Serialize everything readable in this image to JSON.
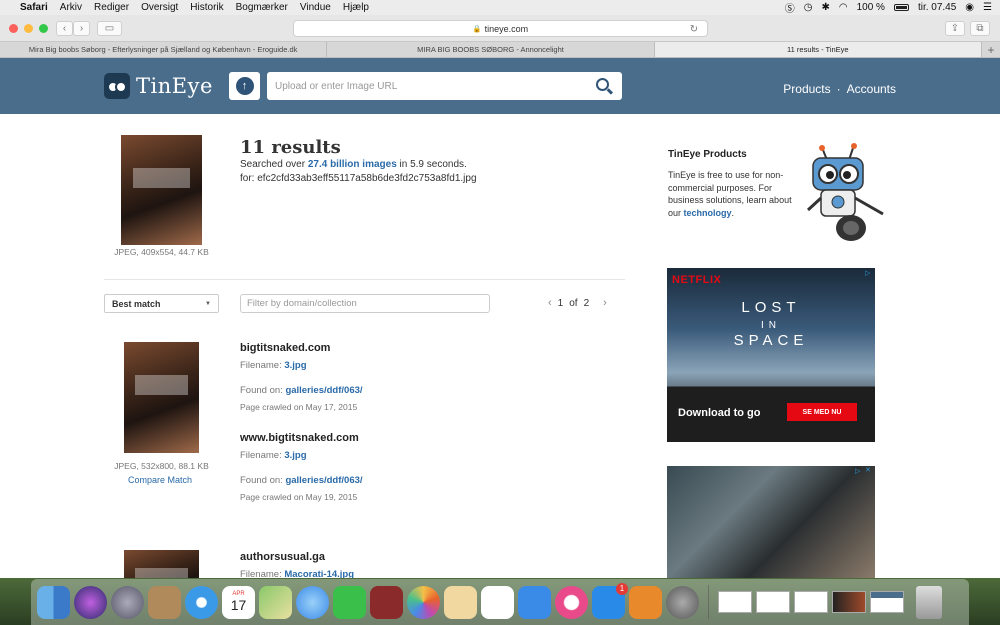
{
  "menubar": {
    "app": "Safari",
    "items": [
      "Arkiv",
      "Rediger",
      "Oversigt",
      "Historik",
      "Bogmærker",
      "Vindue",
      "Hjælp"
    ],
    "battery": "100 %",
    "time": "tir. 07.45"
  },
  "toolbar": {
    "url": "tineye.com"
  },
  "tabs": [
    {
      "title": "Mira Big boobs Søborg - Efterlysninger på Sjælland og København - Eroguide.dk"
    },
    {
      "title": "MIRA BIG BOOBS SØBORG - Annoncelight"
    },
    {
      "title": "11 results - TinEye"
    }
  ],
  "header": {
    "logo_text": "TinEye",
    "search_placeholder": "Upload or enter Image URL",
    "nav": {
      "products": "Products",
      "separator": "·",
      "accounts": "Accounts"
    }
  },
  "query": {
    "meta": "JPEG, 409x554, 44.7 KB",
    "count": "11 results",
    "searched_prefix": "Searched over",
    "searched_bold": "27.4 billion images",
    "searched_suffix": "in 5.9 seconds.",
    "for_hash": "for: efc2cfd33ab3eff55117a58b6de3fd2c753a8fd1.jpg"
  },
  "controls": {
    "sort": "Best match",
    "filter_placeholder": "Filter by domain/collection",
    "page": "1",
    "of": "of",
    "total_pages": "2"
  },
  "results": [
    {
      "meta": "JPEG, 532x800, 88.1 KB",
      "compare": "Compare Match",
      "matches": [
        {
          "domain": "bigtitsnaked.com",
          "filename_label": "Filename:",
          "filename": "3.jpg",
          "found_label": "Found on:",
          "found": "galleries/ddf/063/",
          "crawled": "Page crawled on May 17, 2015"
        },
        {
          "domain": "www.bigtitsnaked.com",
          "filename_label": "Filename:",
          "filename": "3.jpg",
          "found_label": "Found on:",
          "found": "galleries/ddf/063/",
          "crawled": "Page crawled on May 19, 2015"
        }
      ]
    },
    {
      "matches": [
        {
          "domain": "authorsusual.ga",
          "filename_label": "Filename:",
          "filename": "Macorati-14.jpg"
        }
      ]
    }
  ],
  "sidebar": {
    "title": "TinEye Products",
    "text": "TinEye is free to use for non-commercial purposes. For business solutions, learn about our",
    "link": "technology",
    "period": "."
  },
  "ad1": {
    "brand": "NETFLIX",
    "title_line1": "LOST",
    "title_line2": "IN",
    "title_line3": "SPACE",
    "cta_text": "Download to go",
    "cta_button": "SE MED NU"
  },
  "dock": {
    "calendar_month": "APR",
    "calendar_day": "17",
    "appstore_badge": "1"
  },
  "colors": {
    "header_bg": "#4a6d8c",
    "link": "#2a6aa8",
    "netflix_red": "#e50914"
  }
}
